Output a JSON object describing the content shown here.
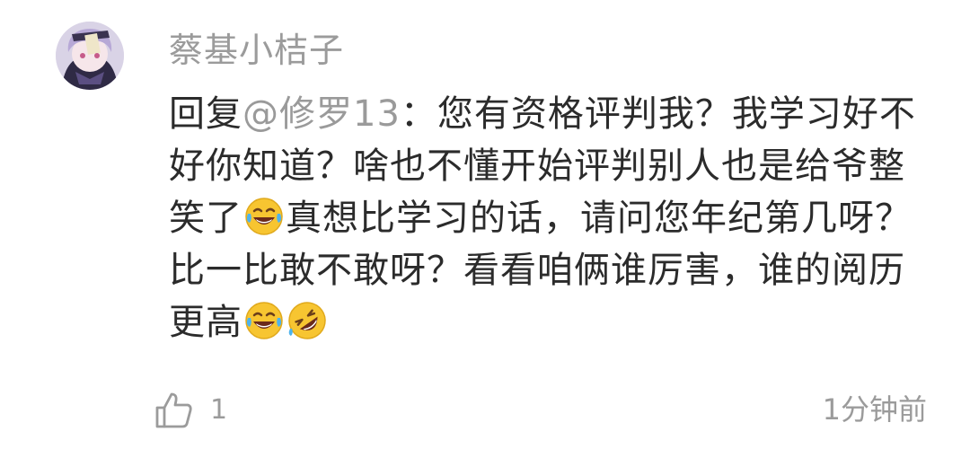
{
  "comment": {
    "username": "蔡基小桔子",
    "reply_prefix": "回复",
    "mention": "@修罗13",
    "separator": "：",
    "text_part1": "您有资格评判我？我学习好不好你知道？啥也不懂开始评判别人也是给爷整笑了",
    "emoji1": "tears-of-joy-emoji",
    "text_part2": "真想比学习的话，请问您年纪第几呀？比一比敢不敢呀？看看咱俩谁厉害，谁的阅历更高",
    "emoji2": "tears-of-joy-emoji",
    "emoji3": "rolling-on-floor-laughing-emoji",
    "like_count": "1",
    "timestamp": "1分钟前"
  },
  "icons": {
    "like": "thumbs-up-outline-icon",
    "avatar": "anime-avatar"
  },
  "colors": {
    "username": "#9b9b9b",
    "mention": "#9a9a9a",
    "text": "#2b2b2b",
    "meta": "#9b9b9b"
  }
}
